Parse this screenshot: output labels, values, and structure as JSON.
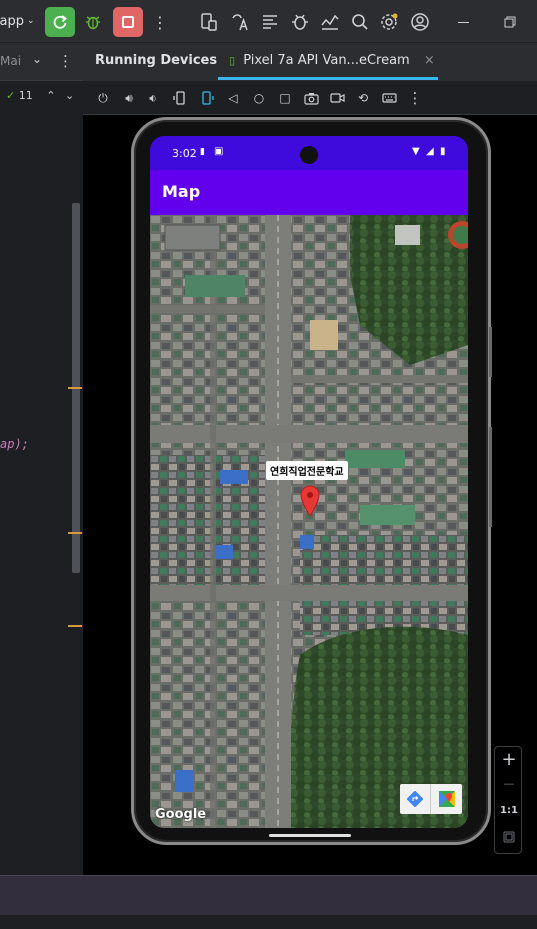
{
  "titlebar": {
    "app_label": "app",
    "run_label": "",
    "icons": [
      "rerun-icon",
      "debug-icon",
      "stop-icon",
      "more-vertical-icon",
      "device-manager-icon",
      "translate-icon",
      "logcat-icon",
      "bug-icon",
      "profiler-icon",
      "search-icon",
      "settings-icon",
      "account-icon",
      "minimize-icon",
      "restore-icon"
    ]
  },
  "editor": {
    "tab_label": "Mai",
    "inspection_count": "11",
    "code_fragment": "ap);"
  },
  "devices": {
    "tab_running": "Running Devices",
    "tab_pixel": "Pixel 7a API Van...eCream",
    "tab_close": "×"
  },
  "phone": {
    "status_time": "3:02",
    "app_title": "Map",
    "marker_label": "연희직업전문학교",
    "google_logo": "Google"
  },
  "zoom": {
    "plus": "+",
    "minus": "—",
    "one_to_one": "1:1"
  },
  "colors": {
    "status_bar": "#3f0bdc",
    "app_bar": "#6200ee",
    "tab_underline": "#3ab6ee",
    "marker": "#e53935",
    "rerun_button": "#4caf50",
    "stop_button": "#e06666"
  }
}
